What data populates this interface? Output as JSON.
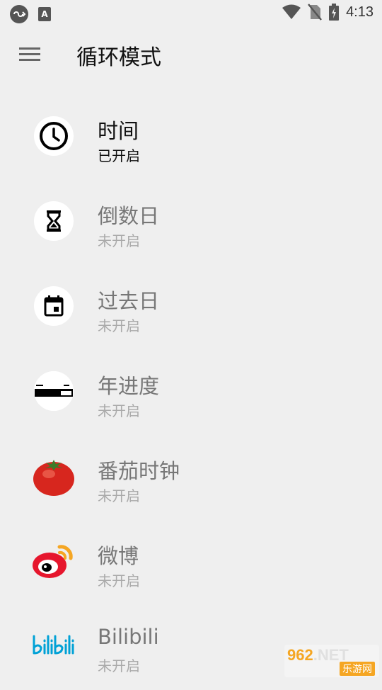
{
  "status_bar": {
    "left_icons": [
      "cloud-link-icon",
      "a-text-icon"
    ],
    "right_icons": [
      "wifi-icon",
      "no-sim-icon",
      "battery-charging-icon"
    ],
    "time": "4:13"
  },
  "app_bar": {
    "title": "循环模式",
    "menu_icon": "hamburger-menu-icon"
  },
  "modes": [
    {
      "title": "时间",
      "status": "已开启",
      "icon": "clock-icon",
      "active": true
    },
    {
      "title": "倒数日",
      "status": "未开启",
      "icon": "hourglass-icon",
      "active": false
    },
    {
      "title": "过去日",
      "status": "未开启",
      "icon": "calendar-icon",
      "active": false
    },
    {
      "title": "年进度",
      "status": "未开启",
      "icon": "progress-bar-icon",
      "active": false
    },
    {
      "title": "番茄时钟",
      "status": "未开启",
      "icon": "tomato-icon",
      "active": false
    },
    {
      "title": "微博",
      "status": "未开启",
      "icon": "weibo-icon",
      "active": false
    },
    {
      "title": "Bilibili",
      "status": "未开启",
      "icon": "bilibili-icon",
      "active": false
    }
  ],
  "watermark": {
    "top": "962",
    "net": ".NET",
    "bottom": "乐游网"
  },
  "colors": {
    "background": "#efefef",
    "active_text": "#111111",
    "inactive_text": "#777777",
    "inactive_status": "#aaaaaa",
    "weibo_red": "#e6162d",
    "weibo_orange": "#f5a623",
    "bilibili_blue": "#00a1d6"
  }
}
